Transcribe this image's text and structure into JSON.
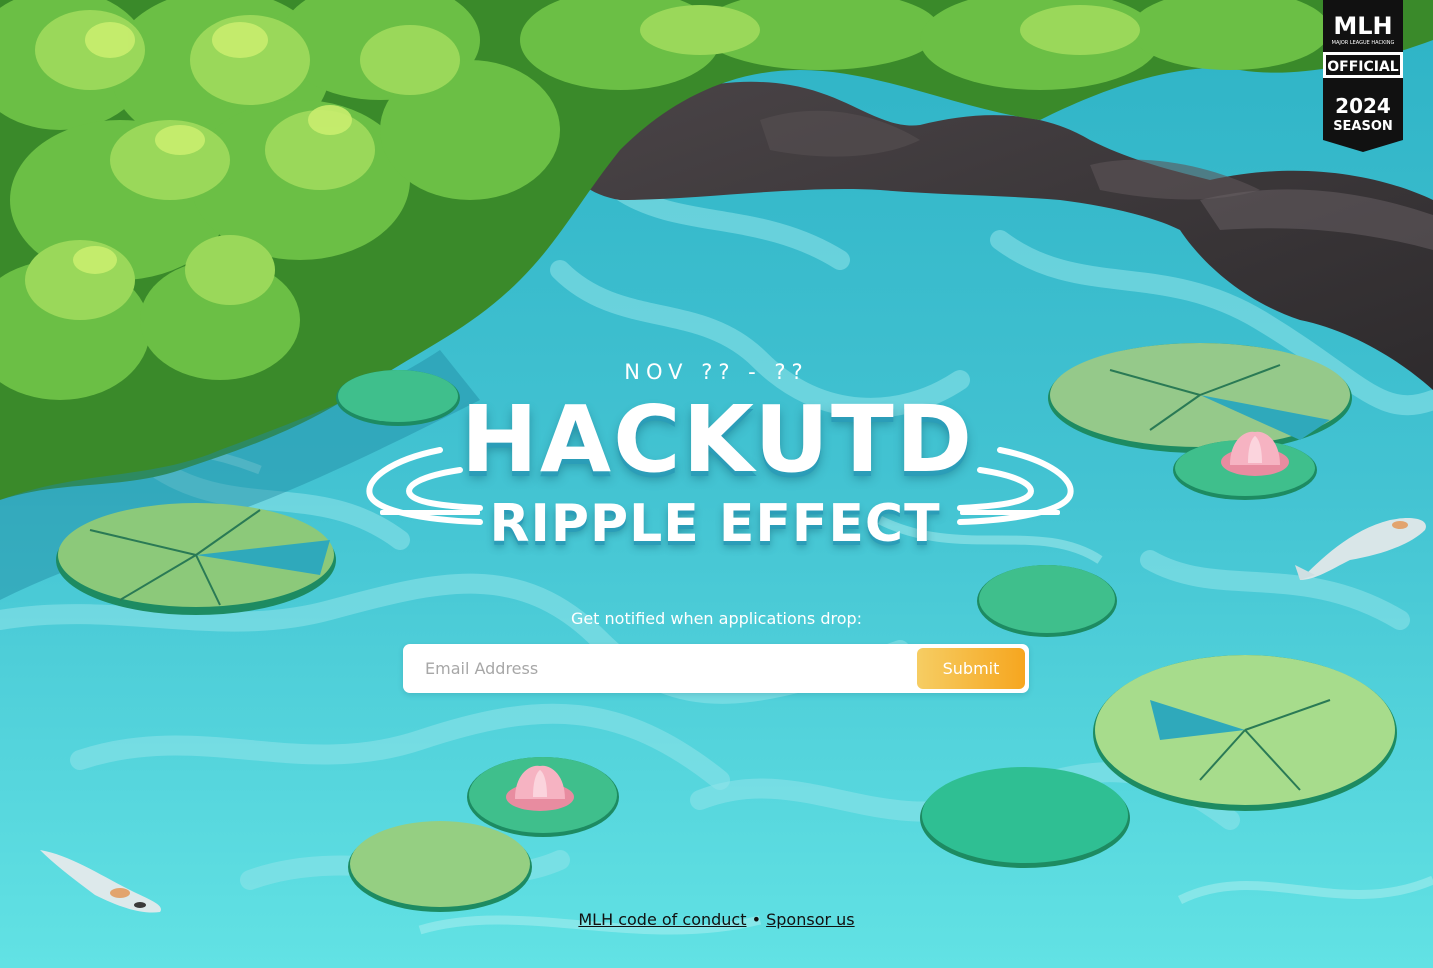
{
  "event": {
    "date": "NOV ?? - ??",
    "title": "HACKUTD",
    "subtitle": "RIPPLE EFFECT"
  },
  "signup": {
    "prompt": "Get notified when applications drop:",
    "email_placeholder": "Email Address",
    "submit_label": "Submit"
  },
  "badge": {
    "brand": "MLH",
    "tagline": "MAJOR LEAGUE HACKING",
    "official": "OFFICIAL",
    "year": "2024",
    "season": "SEASON"
  },
  "footer": {
    "code_of_conduct": "MLH code of conduct",
    "separator": "•",
    "sponsor": "Sponsor us"
  },
  "colors": {
    "water": "#4fcfdb",
    "submit_start": "#f6cd63",
    "submit_end": "#f6a61f",
    "foliage": "#5ea83a",
    "rock": "#3b3a3c"
  }
}
